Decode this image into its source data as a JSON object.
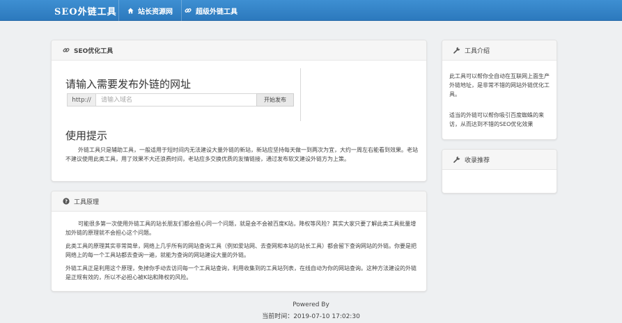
{
  "header": {
    "brand": "SEO外链工具",
    "nav": [
      {
        "label": "站长资源网",
        "icon": "home-icon"
      },
      {
        "label": "超级外链工具",
        "icon": "link-icon"
      }
    ]
  },
  "main_panel": {
    "title": "SEO优化工具",
    "heading": "请输入需要发布外链的网址",
    "input_prefix": "http://",
    "input_placeholder": "请输入域名",
    "submit_label": "开始发布",
    "tips_heading": "使用提示",
    "tips_text": "外链工具只是辅助工具，一般适用于短时间内无法建设大量外链的新站，新站应坚持每天做一到两次为宜，大约一周左右能看到效果。老站不建议使用此类工具，用了效果不大还浪费时间，老站应多交换优质的友情链接，通过发布软文建设外链方为上策。"
  },
  "principle_panel": {
    "title": "工具原理",
    "paragraphs": [
      "可能很多第一次使用外链工具的站长朋友们都会担心同一个问题，就是会不会被百度K站，降权等风险？其实大家只要了解此类工具批量增加外链的原理就不会担心这个问题。",
      "此类工具的原理其实非常简单，网络上几乎所有的网站查询工具（例如爱站网、去查网和本站的站长工具）都会留下查询网站的外链。你要是把网络上的每一个工具站都去查询一遍，就能为查询的网站建设大量的外链。",
      "外链工具正是利用这个原理，免掉你手动去访问每一个工具站查询，利用收集到的工具站列表，在线自动为你的网站查询。这种方法建设的外链是正规有效的，所以不必担心被K站和降权的风险。"
    ]
  },
  "intro_panel": {
    "title": "工具介绍",
    "paragraphs": [
      "此工具可以帮你全自动在互联网上面生产外链地址，是非常不错的网站外链优化工具。",
      "适当的外链可以帮你吸引百度蜘蛛的来访，从而达到不错的SEO优化效果"
    ]
  },
  "recommend_panel": {
    "title": "收录推荐"
  },
  "footer": {
    "powered": "Powered By",
    "time": "当前时间：2019-07-10 17:02:30"
  }
}
